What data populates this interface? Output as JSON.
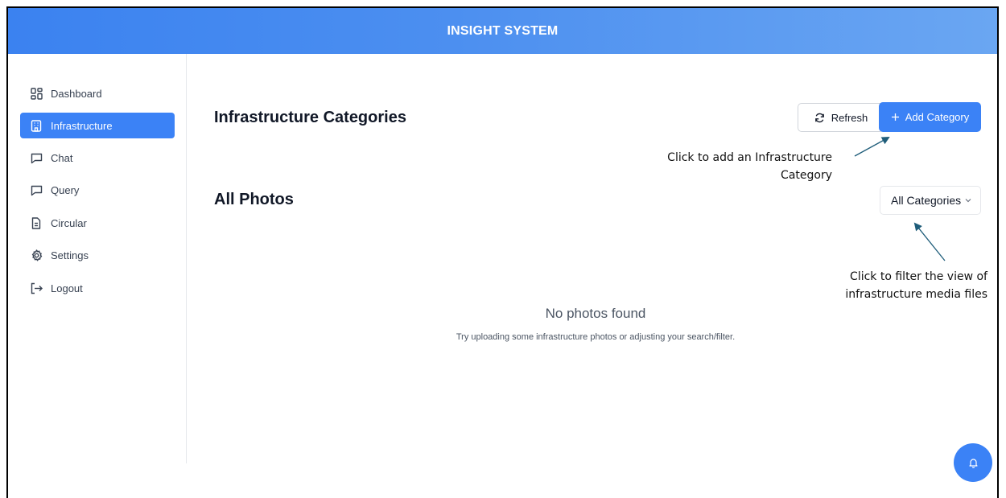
{
  "header": {
    "title": "INSIGHT SYSTEM"
  },
  "sidebar": {
    "items": [
      {
        "label": "Dashboard",
        "icon": "grid-icon",
        "active": false
      },
      {
        "label": "Infrastructure",
        "icon": "building-icon",
        "active": true
      },
      {
        "label": "Chat",
        "icon": "chat-icon",
        "active": false
      },
      {
        "label": "Query",
        "icon": "chat-icon",
        "active": false
      },
      {
        "label": "Circular",
        "icon": "document-icon",
        "active": false
      },
      {
        "label": "Settings",
        "icon": "gear-icon",
        "active": false
      },
      {
        "label": "Logout",
        "icon": "logout-icon",
        "active": false
      }
    ]
  },
  "main": {
    "page_title": "Infrastructure Categories",
    "refresh_label": "Refresh",
    "add_category_label": "Add Category",
    "photos_title": "All Photos",
    "category_filter": {
      "selected": "All Categories"
    },
    "empty_state": {
      "title": "No photos found",
      "subtitle": "Try uploading some infrastructure photos or adjusting your search/filter."
    }
  },
  "annotations": {
    "add_category_note_line1": "Click to add an Infrastructure",
    "add_category_note_line2": "Category",
    "filter_note_line1": "Click to filter the view of",
    "filter_note_line2": "infrastructure media files"
  },
  "notifications": {
    "icon": "bell-icon"
  },
  "colors": {
    "accent": "#3b82f6",
    "header_start": "#3b82f0",
    "header_end": "#6aa6f2",
    "arrow": "#1f5d7a"
  }
}
